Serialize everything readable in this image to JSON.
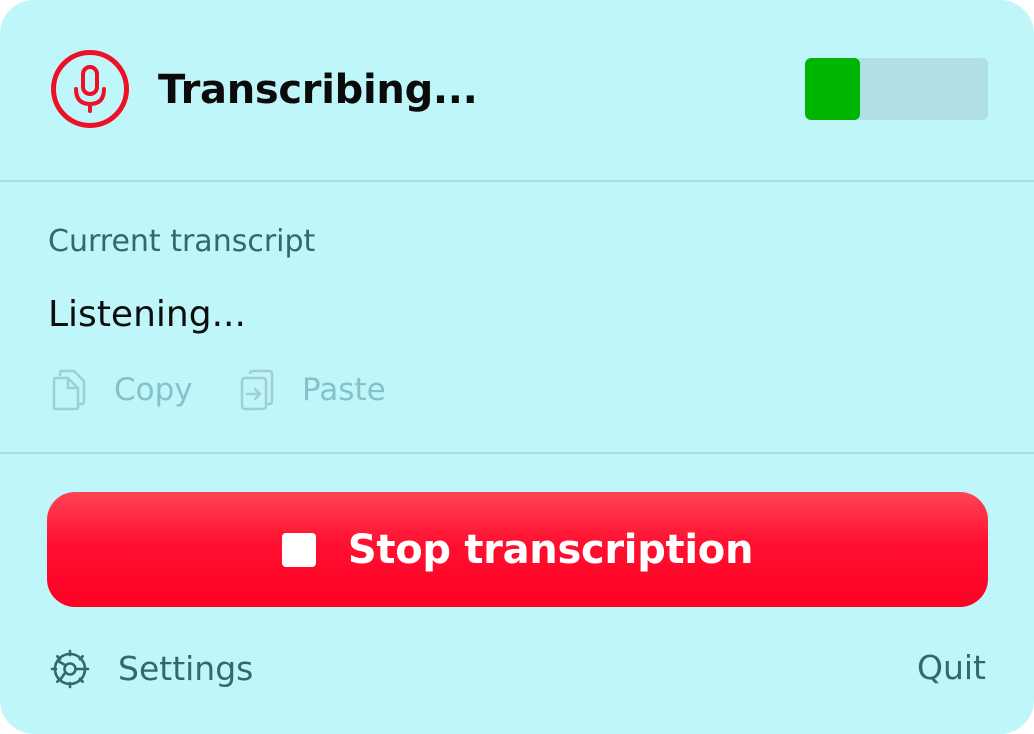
{
  "header": {
    "status_title": "Transcribing...",
    "mic_icon": "microphone-icon",
    "audio_level": 0.3
  },
  "transcript": {
    "section_label": "Current transcript",
    "text": "Listening...",
    "actions": [
      {
        "label": "Copy",
        "icon": "copy-icon",
        "enabled": false
      },
      {
        "label": "Paste",
        "icon": "paste-icon",
        "enabled": false
      }
    ]
  },
  "controls": {
    "stop_label": "Stop transcription",
    "stop_icon": "stop-icon"
  },
  "footer": {
    "settings_label": "Settings",
    "settings_icon": "gear-icon",
    "quit_label": "Quit"
  },
  "colors": {
    "background": "#bff6fa",
    "accent_red": "#ff0a2c",
    "level_green": "#00b500",
    "muted_text": "#2f6a6f",
    "disabled_text": "#86c1c8"
  }
}
